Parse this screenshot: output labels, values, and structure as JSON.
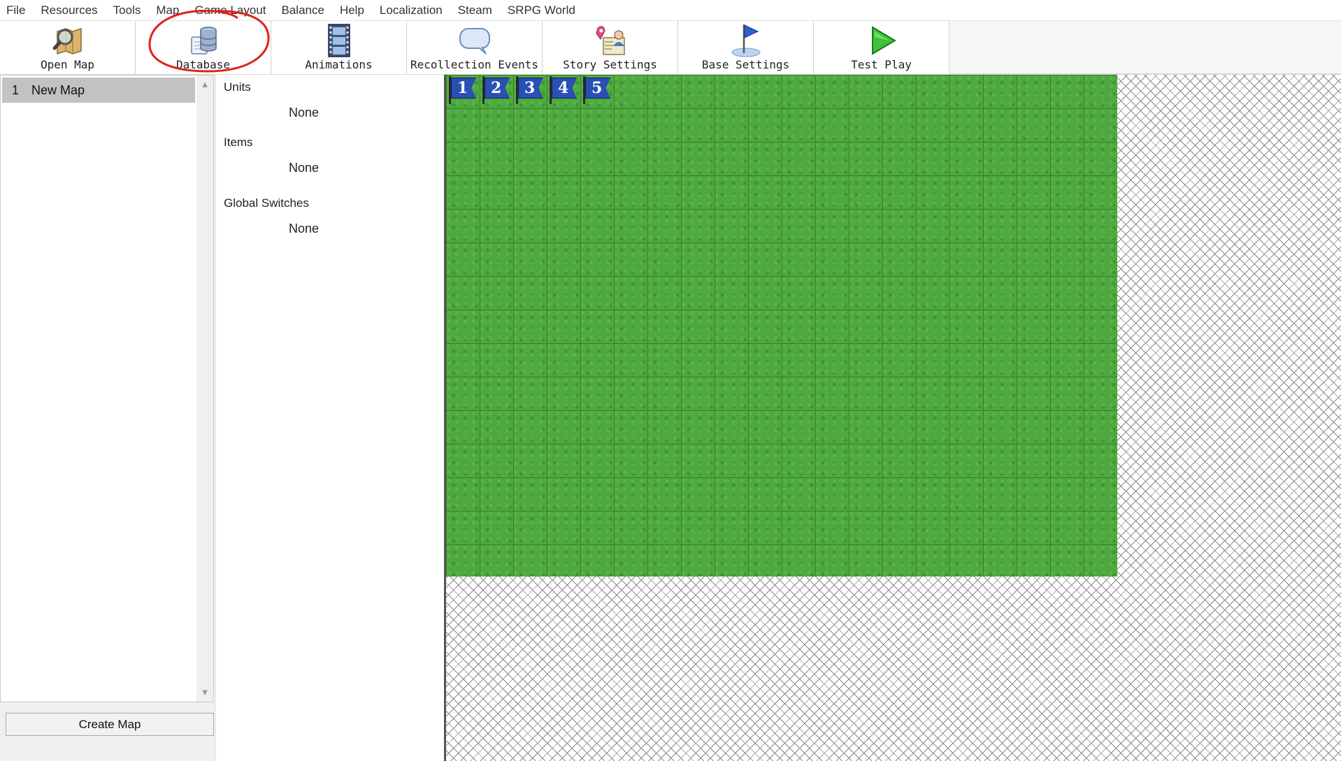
{
  "menu": [
    "File",
    "Resources",
    "Tools",
    "Map",
    "Game Layout",
    "Balance",
    "Help",
    "Localization",
    "Steam",
    "SRPG World"
  ],
  "toolbar": {
    "buttons": [
      {
        "label": "Open Map",
        "icon": "map-magnifier-icon"
      },
      {
        "label": "Database",
        "icon": "database-icon"
      },
      {
        "label": "Animations",
        "icon": "film-strip-icon"
      },
      {
        "label": "Recollection Events",
        "icon": "speech-bubble-icon"
      },
      {
        "label": "Story Settings",
        "icon": "story-people-icon"
      },
      {
        "label": "Base Settings",
        "icon": "blue-flag-icon"
      },
      {
        "label": "Test Play",
        "icon": "play-icon"
      }
    ]
  },
  "map_list": {
    "items": [
      {
        "number": "1",
        "name": "New Map"
      }
    ],
    "create_button": "Create Map"
  },
  "info": {
    "units": {
      "heading": "Units",
      "value": "None"
    },
    "items": {
      "heading": "Items",
      "value": "None"
    },
    "switches": {
      "heading": "Global Switches",
      "value": "None"
    }
  },
  "map": {
    "flags": [
      "1",
      "2",
      "3",
      "4",
      "5"
    ],
    "grass_color": "#4ea93f",
    "flag_color": "#2a4fb5"
  },
  "annotation": {
    "color": "#e0201b",
    "target": "Database"
  }
}
